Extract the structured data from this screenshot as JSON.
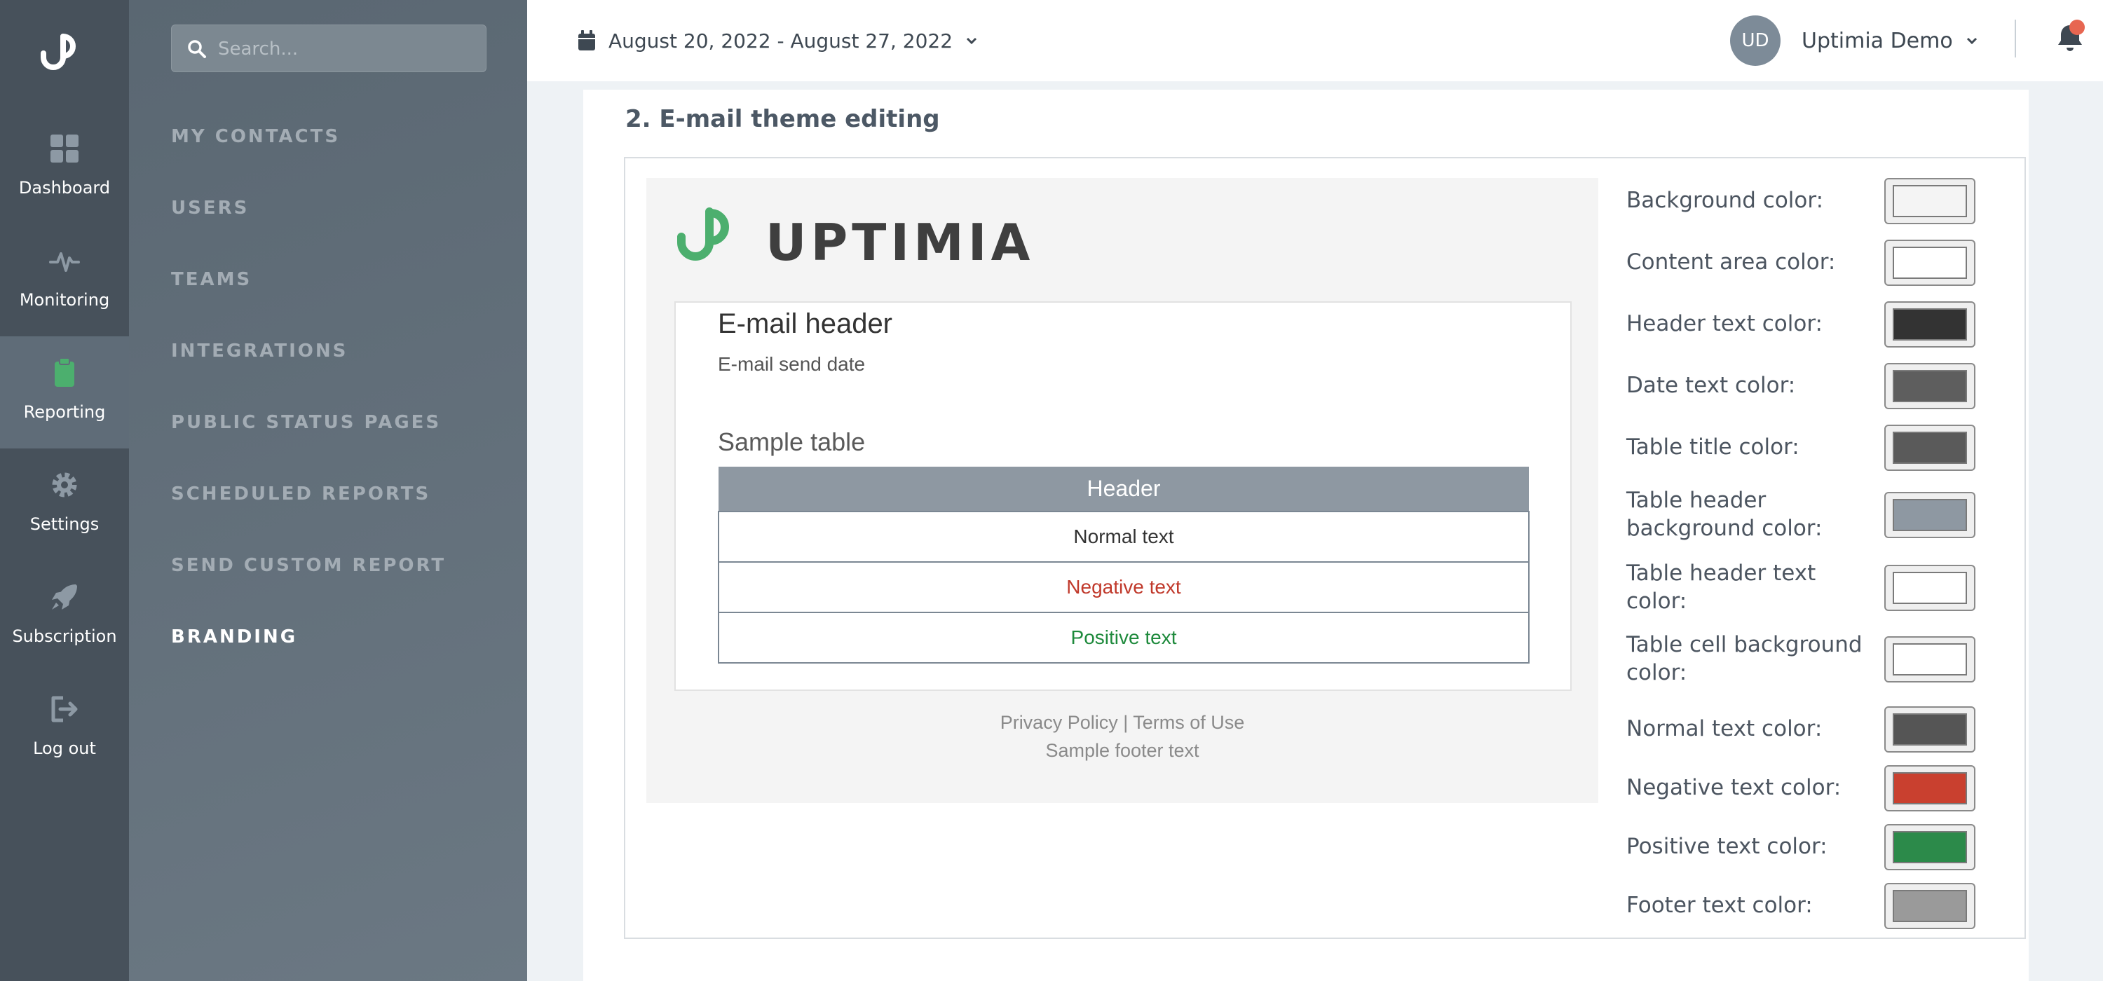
{
  "rail": {
    "items": [
      {
        "label": "Dashboard",
        "icon": "dashboard-icon"
      },
      {
        "label": "Monitoring",
        "icon": "pulse-icon"
      },
      {
        "label": "Reporting",
        "icon": "clipboard-icon",
        "active": true
      },
      {
        "label": "Settings",
        "icon": "gear-icon"
      },
      {
        "label": "Subscription",
        "icon": "rocket-icon"
      },
      {
        "label": "Log out",
        "icon": "logout-icon"
      }
    ]
  },
  "search": {
    "placeholder": "Search..."
  },
  "subnav": {
    "items": [
      {
        "label": "MY CONTACTS"
      },
      {
        "label": "USERS"
      },
      {
        "label": "TEAMS"
      },
      {
        "label": "INTEGRATIONS"
      },
      {
        "label": "PUBLIC STATUS PAGES"
      },
      {
        "label": "SCHEDULED REPORTS"
      },
      {
        "label": "SEND CUSTOM REPORT"
      },
      {
        "label": "BRANDING",
        "active": true
      }
    ]
  },
  "topbar": {
    "date_range": "August 20, 2022 - August 27, 2022",
    "user_initials": "UD",
    "user_name": "Uptimia Demo"
  },
  "section": {
    "title": "2. E-mail theme editing"
  },
  "preview": {
    "brand": "UPTIMIA",
    "header": "E-mail header",
    "send_date": "E-mail send date",
    "table_title": "Sample table",
    "table_header": "Header",
    "rows": [
      {
        "text": "Normal text",
        "color": "#333333"
      },
      {
        "text": "Negative text",
        "color": "#c0392b"
      },
      {
        "text": "Positive text",
        "color": "#1e8a3c"
      }
    ],
    "footer_privacy": "Privacy Policy",
    "footer_sep": " | ",
    "footer_terms": "Terms of Use",
    "footer_text": "Sample footer text"
  },
  "settings": [
    {
      "label": "Background color:",
      "color": "#f4f4f4"
    },
    {
      "label": "Content area color:",
      "color": "#ffffff"
    },
    {
      "label": "Header text color:",
      "color": "#333333"
    },
    {
      "label": "Date text color:",
      "color": "#5e5e5e"
    },
    {
      "label": "Table title color:",
      "color": "#5a5a5a"
    },
    {
      "label": "Table header background color:",
      "color": "#8e98a2"
    },
    {
      "label": "Table header text color:",
      "color": "#ffffff"
    },
    {
      "label": "Table cell background color:",
      "color": "#ffffff"
    },
    {
      "label": "Normal text color:",
      "color": "#555555"
    },
    {
      "label": "Negative text color:",
      "color": "#c9402f"
    },
    {
      "label": "Positive text color:",
      "color": "#2c8a4a"
    },
    {
      "label": "Footer text color:",
      "color": "#9a9a9a"
    }
  ],
  "colors": {
    "accent": "#4caf6e",
    "rail": "#47515b",
    "notification": "#e76651"
  }
}
